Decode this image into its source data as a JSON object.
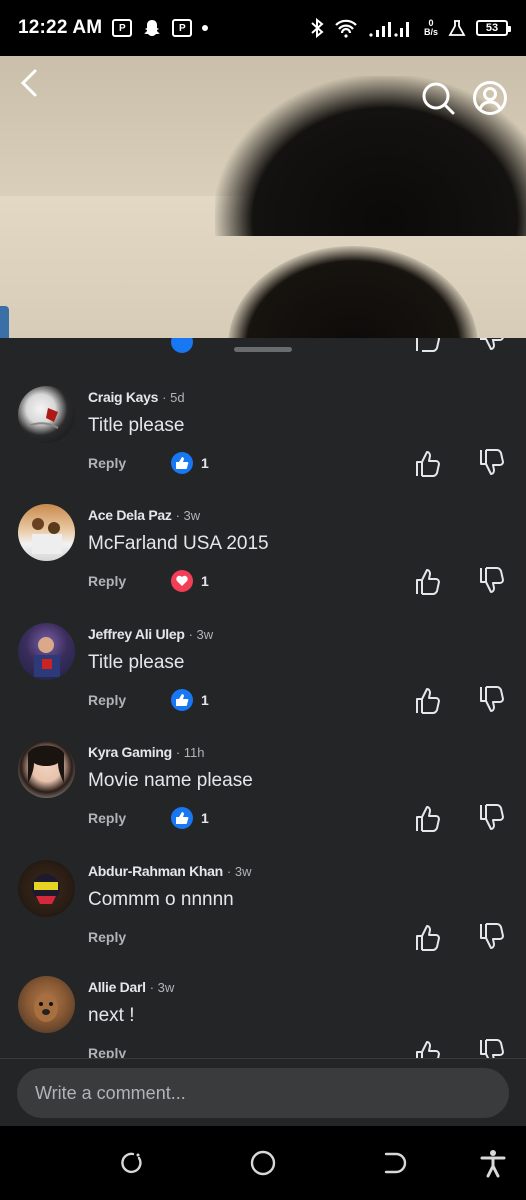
{
  "status_bar": {
    "time": "12:22 AM",
    "speed_value": "0",
    "speed_unit": "B/s",
    "battery": "53"
  },
  "comments": [
    {
      "name": "Craig Kays",
      "time": "· 5d",
      "text": "Title please",
      "reply_label": "Reply",
      "reaction": "like",
      "reaction_count": "1"
    },
    {
      "name": "Ace Dela Paz",
      "time": "· 3w",
      "text": "McFarland USA 2015",
      "reply_label": "Reply",
      "reaction": "love",
      "reaction_count": "1"
    },
    {
      "name": "Jeffrey Ali Ulep",
      "time": "· 3w",
      "text": "Title please",
      "reply_label": "Reply",
      "reaction": "like",
      "reaction_count": "1"
    },
    {
      "name": "Kyra Gaming",
      "time": "· 11h",
      "text": "Movie name please",
      "reply_label": "Reply",
      "reaction": "like",
      "reaction_count": "1"
    },
    {
      "name": "Abdur-Rahman Khan",
      "time": "· 3w",
      "text": "Commm o nnnnn",
      "reply_label": "Reply",
      "reaction": null,
      "reaction_count": null
    },
    {
      "name": "Allie Darl",
      "time": "· 3w",
      "text": "next !",
      "reply_label": "Reply",
      "reaction": null,
      "reaction_count": null
    }
  ],
  "input": {
    "placeholder": "Write a comment..."
  },
  "colors": {
    "panel_bg": "#242526",
    "like_blue": "#1877f2",
    "love_red": "#f33e58",
    "text_primary": "#e4e6eb",
    "text_secondary": "#b0b3b8"
  }
}
